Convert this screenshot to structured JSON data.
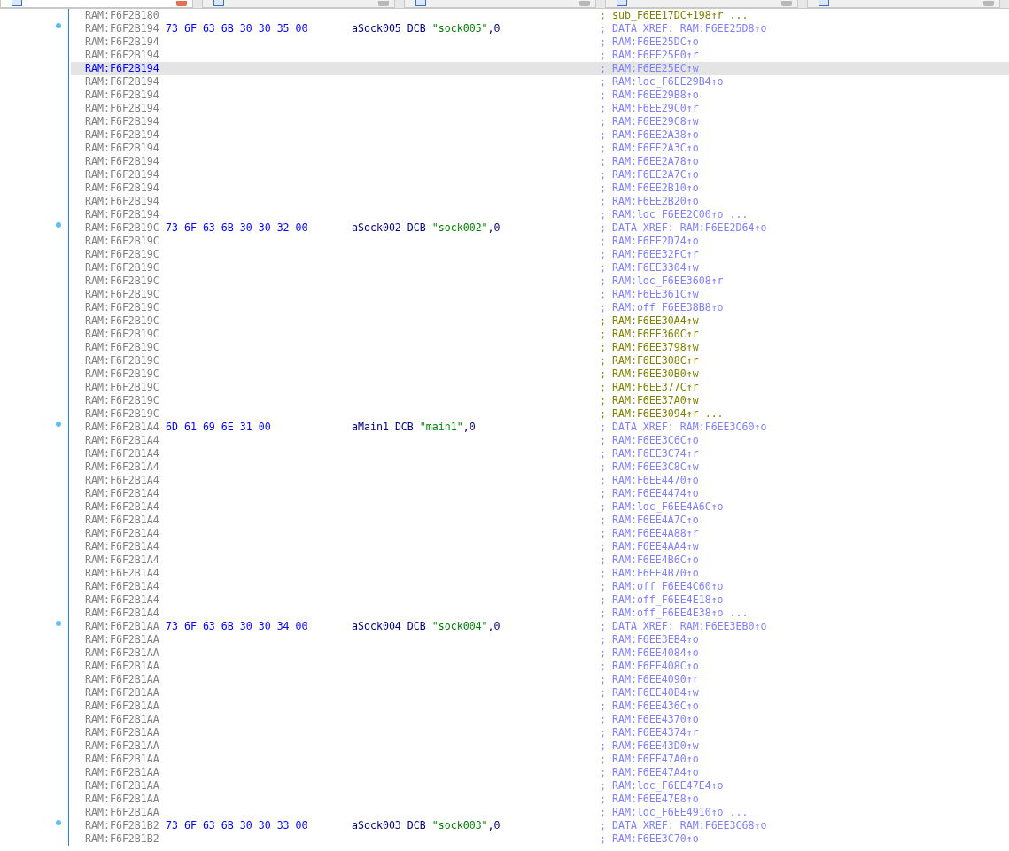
{
  "tabs": [
    {
      "selected": true
    },
    {
      "selected": false
    },
    {
      "selected": false
    },
    {
      "selected": false
    },
    {
      "selected": false
    }
  ],
  "listing": {
    "rows": [
      {
        "address": "RAM:F6F2B180",
        "comment": "; sub_F6EE17DC+198↑r ...",
        "color": "#808000",
        "selected": false,
        "marked": false
      },
      {
        "address": "RAM:F6F2B194",
        "bytes": "73 6F 63 6B 30 30 35 00",
        "label": "aSock005",
        "directive": "DCB",
        "string": "\"sock005\"",
        "suffix": ",0",
        "comment": "; DATA XREF: RAM:F6EE25D8↑o",
        "color": "#8080ff",
        "selected": false,
        "marked": true
      },
      {
        "address": "RAM:F6F2B194",
        "comment": "; RAM:F6EE25DC↑o",
        "color": "#8080ff",
        "selected": false,
        "marked": false
      },
      {
        "address": "RAM:F6F2B194",
        "comment": "; RAM:F6EE25E0↑r",
        "color": "#8080ff",
        "selected": false,
        "marked": false
      },
      {
        "address": "RAM:F6F2B194",
        "comment": "; RAM:F6EE25EC↑w",
        "color": "#8080ff",
        "selected": true,
        "marked": false
      },
      {
        "address": "RAM:F6F2B194",
        "comment": "; RAM:loc_F6EE29B4↑o",
        "color": "#8080ff",
        "selected": false,
        "marked": false
      },
      {
        "address": "RAM:F6F2B194",
        "comment": "; RAM:F6EE29B8↑o",
        "color": "#8080ff",
        "selected": false,
        "marked": false
      },
      {
        "address": "RAM:F6F2B194",
        "comment": "; RAM:F6EE29C0↑r",
        "color": "#8080ff",
        "selected": false,
        "marked": false
      },
      {
        "address": "RAM:F6F2B194",
        "comment": "; RAM:F6EE29C8↑w",
        "color": "#8080ff",
        "selected": false,
        "marked": false
      },
      {
        "address": "RAM:F6F2B194",
        "comment": "; RAM:F6EE2A38↑o",
        "color": "#8080ff",
        "selected": false,
        "marked": false
      },
      {
        "address": "RAM:F6F2B194",
        "comment": "; RAM:F6EE2A3C↑o",
        "color": "#8080ff",
        "selected": false,
        "marked": false
      },
      {
        "address": "RAM:F6F2B194",
        "comment": "; RAM:F6EE2A78↑o",
        "color": "#8080ff",
        "selected": false,
        "marked": false
      },
      {
        "address": "RAM:F6F2B194",
        "comment": "; RAM:F6EE2A7C↑o",
        "color": "#8080ff",
        "selected": false,
        "marked": false
      },
      {
        "address": "RAM:F6F2B194",
        "comment": "; RAM:F6EE2B10↑o",
        "color": "#8080ff",
        "selected": false,
        "marked": false
      },
      {
        "address": "RAM:F6F2B194",
        "comment": "; RAM:F6EE2B20↑o",
        "color": "#8080ff",
        "selected": false,
        "marked": false
      },
      {
        "address": "RAM:F6F2B194",
        "comment": "; RAM:loc_F6EE2C00↑o ...",
        "color": "#8080ff",
        "selected": false,
        "marked": false
      },
      {
        "address": "RAM:F6F2B19C",
        "bytes": "73 6F 63 6B 30 30 32 00",
        "label": "aSock002",
        "directive": "DCB",
        "string": "\"sock002\"",
        "suffix": ",0",
        "comment": "; DATA XREF: RAM:F6EE2D64↑o",
        "color": "#8080ff",
        "selected": false,
        "marked": true
      },
      {
        "address": "RAM:F6F2B19C",
        "comment": "; RAM:F6EE2D74↑o",
        "color": "#8080ff",
        "selected": false,
        "marked": false
      },
      {
        "address": "RAM:F6F2B19C",
        "comment": "; RAM:F6EE32FC↑r",
        "color": "#8080ff",
        "selected": false,
        "marked": false
      },
      {
        "address": "RAM:F6F2B19C",
        "comment": "; RAM:F6EE3304↑w",
        "color": "#8080ff",
        "selected": false,
        "marked": false
      },
      {
        "address": "RAM:F6F2B19C",
        "comment": "; RAM:loc_F6EE3608↑r",
        "color": "#8080ff",
        "selected": false,
        "marked": false
      },
      {
        "address": "RAM:F6F2B19C",
        "comment": "; RAM:F6EE361C↑w",
        "color": "#8080ff",
        "selected": false,
        "marked": false
      },
      {
        "address": "RAM:F6F2B19C",
        "comment": "; RAM:off_F6EE38B8↑o",
        "color": "#8080ff",
        "selected": false,
        "marked": false
      },
      {
        "address": "RAM:F6F2B19C",
        "comment": "; RAM:F6EE30A4↑w",
        "color": "#808000",
        "selected": false,
        "marked": false
      },
      {
        "address": "RAM:F6F2B19C",
        "comment": "; RAM:F6EE360C↑r",
        "color": "#808000",
        "selected": false,
        "marked": false
      },
      {
        "address": "RAM:F6F2B19C",
        "comment": "; RAM:F6EE3798↑w",
        "color": "#808000",
        "selected": false,
        "marked": false
      },
      {
        "address": "RAM:F6F2B19C",
        "comment": "; RAM:F6EE308C↑r",
        "color": "#808000",
        "selected": false,
        "marked": false
      },
      {
        "address": "RAM:F6F2B19C",
        "comment": "; RAM:F6EE30B0↑w",
        "color": "#808000",
        "selected": false,
        "marked": false
      },
      {
        "address": "RAM:F6F2B19C",
        "comment": "; RAM:F6EE377C↑r",
        "color": "#808000",
        "selected": false,
        "marked": false
      },
      {
        "address": "RAM:F6F2B19C",
        "comment": "; RAM:F6EE37A0↑w",
        "color": "#808000",
        "selected": false,
        "marked": false
      },
      {
        "address": "RAM:F6F2B19C",
        "comment": "; RAM:F6EE3094↑r ...",
        "color": "#808000",
        "selected": false,
        "marked": false
      },
      {
        "address": "RAM:F6F2B1A4",
        "bytes": "6D 61 69 6E 31 00",
        "label": "aMain1",
        "directive": "DCB",
        "string": "\"main1\"",
        "suffix": ",0",
        "comment": "; DATA XREF: RAM:F6EE3C60↑o",
        "color": "#8080ff",
        "selected": false,
        "marked": true
      },
      {
        "address": "RAM:F6F2B1A4",
        "comment": "; RAM:F6EE3C6C↑o",
        "color": "#8080ff",
        "selected": false,
        "marked": false
      },
      {
        "address": "RAM:F6F2B1A4",
        "comment": "; RAM:F6EE3C74↑r",
        "color": "#8080ff",
        "selected": false,
        "marked": false
      },
      {
        "address": "RAM:F6F2B1A4",
        "comment": "; RAM:F6EE3C8C↑w",
        "color": "#8080ff",
        "selected": false,
        "marked": false
      },
      {
        "address": "RAM:F6F2B1A4",
        "comment": "; RAM:F6EE4470↑o",
        "color": "#8080ff",
        "selected": false,
        "marked": false
      },
      {
        "address": "RAM:F6F2B1A4",
        "comment": "; RAM:F6EE4474↑o",
        "color": "#8080ff",
        "selected": false,
        "marked": false
      },
      {
        "address": "RAM:F6F2B1A4",
        "comment": "; RAM:loc_F6EE4A6C↑o",
        "color": "#8080ff",
        "selected": false,
        "marked": false
      },
      {
        "address": "RAM:F6F2B1A4",
        "comment": "; RAM:F6EE4A7C↑o",
        "color": "#8080ff",
        "selected": false,
        "marked": false
      },
      {
        "address": "RAM:F6F2B1A4",
        "comment": "; RAM:F6EE4A88↑r",
        "color": "#8080ff",
        "selected": false,
        "marked": false
      },
      {
        "address": "RAM:F6F2B1A4",
        "comment": "; RAM:F6EE4AA4↑w",
        "color": "#8080ff",
        "selected": false,
        "marked": false
      },
      {
        "address": "RAM:F6F2B1A4",
        "comment": "; RAM:F6EE4B6C↑o",
        "color": "#8080ff",
        "selected": false,
        "marked": false
      },
      {
        "address": "RAM:F6F2B1A4",
        "comment": "; RAM:F6EE4B70↑o",
        "color": "#8080ff",
        "selected": false,
        "marked": false
      },
      {
        "address": "RAM:F6F2B1A4",
        "comment": "; RAM:off_F6EE4C60↑o",
        "color": "#8080ff",
        "selected": false,
        "marked": false
      },
      {
        "address": "RAM:F6F2B1A4",
        "comment": "; RAM:off_F6EE4E18↑o",
        "color": "#8080ff",
        "selected": false,
        "marked": false
      },
      {
        "address": "RAM:F6F2B1A4",
        "comment": "; RAM:off_F6EE4E38↑o ...",
        "color": "#8080ff",
        "selected": false,
        "marked": false
      },
      {
        "address": "RAM:F6F2B1AA",
        "bytes": "73 6F 63 6B 30 30 34 00",
        "label": "aSock004",
        "directive": "DCB",
        "string": "\"sock004\"",
        "suffix": ",0",
        "comment": "; DATA XREF: RAM:F6EE3EB0↑o",
        "color": "#8080ff",
        "selected": false,
        "marked": true
      },
      {
        "address": "RAM:F6F2B1AA",
        "comment": "; RAM:F6EE3EB4↑o",
        "color": "#8080ff",
        "selected": false,
        "marked": false
      },
      {
        "address": "RAM:F6F2B1AA",
        "comment": "; RAM:F6EE4084↑o",
        "color": "#8080ff",
        "selected": false,
        "marked": false
      },
      {
        "address": "RAM:F6F2B1AA",
        "comment": "; RAM:F6EE408C↑o",
        "color": "#8080ff",
        "selected": false,
        "marked": false
      },
      {
        "address": "RAM:F6F2B1AA",
        "comment": "; RAM:F6EE4090↑r",
        "color": "#8080ff",
        "selected": false,
        "marked": false
      },
      {
        "address": "RAM:F6F2B1AA",
        "comment": "; RAM:F6EE40B4↑w",
        "color": "#8080ff",
        "selected": false,
        "marked": false
      },
      {
        "address": "RAM:F6F2B1AA",
        "comment": "; RAM:F6EE436C↑o",
        "color": "#8080ff",
        "selected": false,
        "marked": false
      },
      {
        "address": "RAM:F6F2B1AA",
        "comment": "; RAM:F6EE4370↑o",
        "color": "#8080ff",
        "selected": false,
        "marked": false
      },
      {
        "address": "RAM:F6F2B1AA",
        "comment": "; RAM:F6EE4374↑r",
        "color": "#8080ff",
        "selected": false,
        "marked": false
      },
      {
        "address": "RAM:F6F2B1AA",
        "comment": "; RAM:F6EE43D0↑w",
        "color": "#8080ff",
        "selected": false,
        "marked": false
      },
      {
        "address": "RAM:F6F2B1AA",
        "comment": "; RAM:F6EE47A0↑o",
        "color": "#8080ff",
        "selected": false,
        "marked": false
      },
      {
        "address": "RAM:F6F2B1AA",
        "comment": "; RAM:F6EE47A4↑o",
        "color": "#8080ff",
        "selected": false,
        "marked": false
      },
      {
        "address": "RAM:F6F2B1AA",
        "comment": "; RAM:loc_F6EE47E4↑o",
        "color": "#8080ff",
        "selected": false,
        "marked": false
      },
      {
        "address": "RAM:F6F2B1AA",
        "comment": "; RAM:F6EE47E8↑o",
        "color": "#8080ff",
        "selected": false,
        "marked": false
      },
      {
        "address": "RAM:F6F2B1AA",
        "comment": "; RAM:loc_F6EE4910↑o ...",
        "color": "#8080ff",
        "selected": false,
        "marked": false
      },
      {
        "address": "RAM:F6F2B1B2",
        "bytes": "73 6F 63 6B 30 30 33 00",
        "label": "aSock003",
        "directive": "DCB",
        "string": "\"sock003\"",
        "suffix": ",0",
        "comment": "; DATA XREF: RAM:F6EE3C68↑o",
        "color": "#8080ff",
        "selected": false,
        "marked": true
      },
      {
        "address": "RAM:F6F2B1B2",
        "comment": "; RAM:F6EE3C70↑o",
        "color": "#8080ff",
        "selected": false,
        "marked": false
      }
    ]
  }
}
